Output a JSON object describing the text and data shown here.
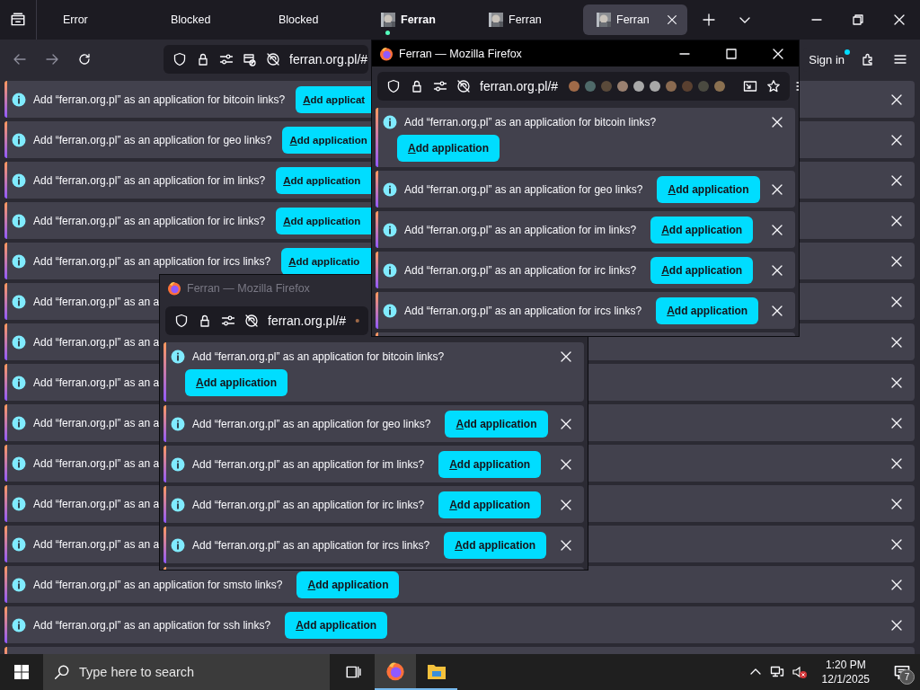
{
  "tab_strip": {
    "tabs": [
      {
        "label": "Error",
        "kind": "text",
        "bold": false,
        "attention": false,
        "selected": false
      },
      {
        "label": "Blocked",
        "kind": "text",
        "bold": false,
        "attention": false,
        "selected": false
      },
      {
        "label": "Blocked",
        "kind": "text",
        "bold": false,
        "attention": false,
        "selected": false
      },
      {
        "label": "Ferran",
        "kind": "favicon",
        "bold": true,
        "attention": true,
        "selected": false
      },
      {
        "label": "Ferran",
        "kind": "favicon",
        "bold": false,
        "attention": false,
        "selected": false
      },
      {
        "label": "Ferran",
        "kind": "favicon",
        "bold": false,
        "attention": false,
        "selected": true
      }
    ]
  },
  "toolbar": {
    "url": "ferran.org.pl/#",
    "sign_in": "Sign in"
  },
  "notifications": [
    {
      "kind": "cut",
      "text": "Add “ferran.org.pl” as an application for bitcoin links?",
      "button": "Add applicat"
    },
    {
      "kind": "cut",
      "text": "Add “ferran.org.pl” as an application for geo links?",
      "button": "Add application"
    },
    {
      "kind": "cut",
      "text": "Add “ferran.org.pl” as an application for im links?",
      "button": "Add application"
    },
    {
      "kind": "cut",
      "text": "Add “ferran.org.pl” as an application for irc links?",
      "button": "Add application"
    },
    {
      "kind": "cut",
      "text": "Add “ferran.org.pl” as an application for ircs links?",
      "button": "Add applicatio"
    },
    {
      "kind": "inline",
      "text": "Add “ferran.org.pl” as an a"
    },
    {
      "kind": "inline",
      "text": "Add “ferran.org.pl” as an a"
    },
    {
      "kind": "inline",
      "text": "Add “ferran.org.pl” as an a"
    },
    {
      "kind": "inline",
      "text": "Add “ferran.org.pl” as an a"
    },
    {
      "kind": "inline",
      "text": "Add “ferran.org.pl” as an a"
    },
    {
      "kind": "inline",
      "text": "Add “ferran.org.pl” as an a"
    },
    {
      "kind": "inline",
      "text": "Add “ferran.org.pl” as an a"
    },
    {
      "kind": "inline",
      "text": "Add “ferran.org.pl” as an application for smsto links?",
      "button": "Add application"
    },
    {
      "kind": "inline",
      "text": "Add “ferran.org.pl” as an application for ssh links?",
      "button": "Add application"
    }
  ],
  "windows": [
    {
      "title": "Ferran — Mozilla Firefox",
      "active": true,
      "url": "ferran.org.pl/#",
      "controls_visible": true,
      "notifications": [
        {
          "kind": "stacked",
          "text": "Add “ferran.org.pl” as an application for bitcoin links?",
          "button": "Add application"
        },
        {
          "kind": "inline",
          "text": "Add “ferran.org.pl” as an application for geo links?",
          "button": "Add application"
        },
        {
          "kind": "inline",
          "text": "Add “ferran.org.pl” as an application for im links?",
          "button": "Add application"
        },
        {
          "kind": "inline",
          "text": "Add “ferran.org.pl” as an application for irc links?",
          "button": "Add application"
        },
        {
          "kind": "inline",
          "text": "Add “ferran.org.pl” as an application for ircs links?",
          "button": "Add application"
        }
      ]
    },
    {
      "title": "Ferran — Mozilla Firefox",
      "active": false,
      "url": "ferran.org.pl/#",
      "controls_visible": false,
      "notifications": [
        {
          "kind": "stacked",
          "text": "Add “ferran.org.pl” as an application for bitcoin links?",
          "button": "Add application"
        },
        {
          "kind": "inline",
          "text": "Add “ferran.org.pl” as an application for geo links?",
          "button": "Add application"
        },
        {
          "kind": "inline",
          "text": "Add “ferran.org.pl” as an application for im links?",
          "button": "Add application"
        },
        {
          "kind": "inline",
          "text": "Add “ferran.org.pl” as an application for irc links?",
          "button": "Add application"
        },
        {
          "kind": "inline",
          "text": "Add “ferran.org.pl” as an application for ircs links?",
          "button": "Add application"
        }
      ]
    }
  ],
  "taskbar": {
    "placeholder": "Type here to search",
    "apps": [
      {
        "kind": "firefox",
        "active": true
      },
      {
        "kind": "explorer",
        "active": false
      }
    ],
    "time": "1:20 PM",
    "date": "12/1/2025",
    "notification_count": "7"
  }
}
